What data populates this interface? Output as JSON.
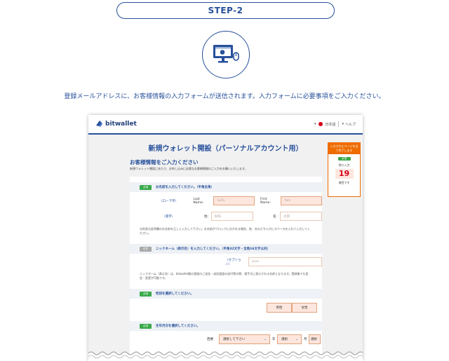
{
  "step": {
    "label": "STEP-2"
  },
  "instruction": "登録メールアドレスに、お客様情報の入力フォームが送信されます。入力フォームに必要事項をご入力ください。",
  "screenshot": {
    "brand": "bitwallet",
    "header": {
      "language": "日本語",
      "help": "ヘルプ"
    },
    "page_title": "新規ウォレット開設（パーソナルアカウント用）",
    "section_title": "お客様情報をご入力ください",
    "section_subtitle": "新規ウォレット開設にあたり、お申し込みに必要なお客様情報のご入力をお願いいたします。",
    "side_panel": {
      "heading": "入力されたページを全て完了します",
      "tag": "必須",
      "remaining_label": "残り入力",
      "remaining_count": "19",
      "unit": "項目です"
    },
    "name_block": {
      "tag": "必須",
      "label": "お名前を入力してください。（半角全角）",
      "roman_label": "（ローマ字）",
      "last_name_label": "Last Name:",
      "last_name_placeholder": "Saifu",
      "first_name_label": "First Name:",
      "first_name_placeholder": "Taro",
      "kanji_label": "（漢字）",
      "sei_label": "姓:",
      "sei_placeholder": "財布",
      "mei_label": "名:",
      "mei_placeholder": "太郎",
      "note": "分的身分証明書のお名前を正しく入力して下さい。お名前がブロックに分かれる場合、姓、名のどちらかにスペースを入れて入力してください。"
    },
    "nickname_block": {
      "tag": "任意",
      "label": "ニックネーム（表示名）を入力してください。（半角32文字・全角16文字以内）",
      "option_label": "（オプション）",
      "placeholder": "Jone",
      "note": "ニックネーム（表示名）は、bitwallet間の直接のご送金・送信画面の送付等の際、相手方に表示される名前となります。登録後でも設定・変更が可能です。"
    },
    "gender_block": {
      "tag": "必須",
      "label": "性別を選択してください。",
      "male": "男性",
      "female": "女性"
    },
    "birth_block": {
      "tag": "必須",
      "label": "生年月日を選択してください。",
      "era_label": "西暦",
      "year_select": "選択して下さい",
      "year_suffix": "年",
      "month_select": "選択",
      "month_suffix": "月",
      "day_select": "選択",
      "day_suffix": "日"
    }
  }
}
